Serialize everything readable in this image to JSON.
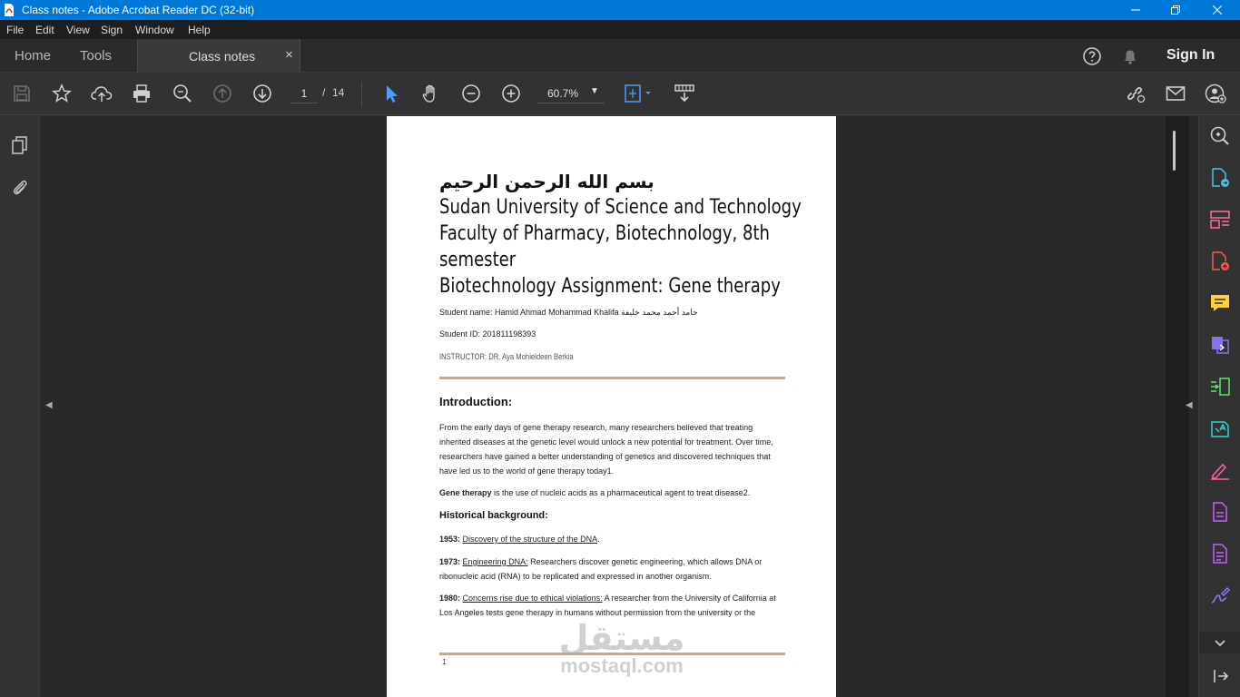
{
  "window": {
    "title": "Class notes - Adobe Acrobat Reader DC (32-bit)"
  },
  "menu": [
    "File",
    "Edit",
    "View",
    "Sign",
    "Window",
    "Help"
  ],
  "tabs": {
    "home": "Home",
    "tools": "Tools",
    "document": "Class notes",
    "close_glyph": "×",
    "sign_in": "Sign In"
  },
  "toolbar": {
    "page_current": "1",
    "page_separator": "/",
    "page_total": "14",
    "zoom": "60.7%"
  },
  "document": {
    "bismillah": "بسم الله الرحمن الرحيم",
    "title_line1": "Sudan University of Science and Technology",
    "title_line2": "Faculty of Pharmacy, Biotechnology, 8th",
    "title_line3": "semester",
    "subtitle": "Biotechnology Assignment: Gene therapy",
    "student_name": "Student name: Hamid Ahmad Mohammad Khalifa حامد أحمد محمد خليفة",
    "student_id": "Student ID: 201811198393",
    "instructor": "INSTRUCTOR: DR. Aya Mohieldeen Berkia",
    "intro_heading": "Introduction:",
    "intro_paragraph": "From the early days of gene therapy research, many researchers believed that treating inherited diseases at the genetic level would unlock a new potential for treatment. Over time, researchers have gained a better understanding of genetics and discovered techniques that have led us to the world of gene therapy today1.",
    "gene_therapy_term": "Gene therapy",
    "gene_therapy_def": " is the use of nucleic acids as a pharmaceutical agent to treat disease2.",
    "history_heading": "Historical background:",
    "h1953_year": "1953:",
    "h1953_link": "Discovery of the structure of the DNA",
    "h1953_end": ".",
    "h1973_year": "1973:",
    "h1973_link": "Engineering DNA:",
    "h1973_text": " Researchers discover genetic engineering, which allows DNA or ribonucleic acid (RNA) to be replicated and expressed in another organism.",
    "h1980_year": "1980:",
    "h1980_link": "Concerns rise due to ethical violations:",
    "h1980_text": " A researcher from the University of California at Los Angeles tests gene therapy in humans without permission from the university or the",
    "page_number": "1"
  },
  "watermark": {
    "arabic": "مستقل",
    "latin": "mostaql.com"
  },
  "colors": {
    "titlebar": "#0078d7",
    "accent_blue": "#4a9eff",
    "rule": "#c9a98a"
  }
}
